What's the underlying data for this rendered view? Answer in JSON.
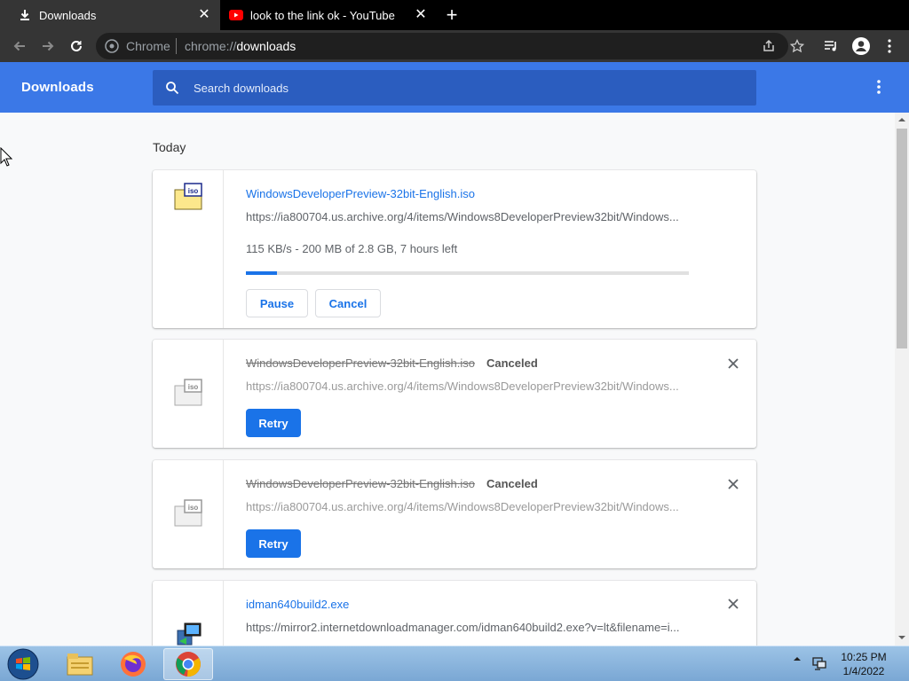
{
  "tabs": [
    {
      "title": "Downloads",
      "icon": "download-icon",
      "active": true
    },
    {
      "title": "look to the link ok - YouTube",
      "icon": "youtube-icon",
      "active": false
    }
  ],
  "omnibox": {
    "scheme_label": "Chrome",
    "url_prefix": "chrome://",
    "url_host": "downloads"
  },
  "header": {
    "title": "Downloads",
    "search_placeholder": "Search downloads"
  },
  "section_label": "Today",
  "downloads": [
    {
      "filename": "WindowsDeveloperPreview-32bit-English.iso",
      "url": "https://ia800704.us.archive.org/4/items/Windows8DeveloperPreview32bit/Windows...",
      "progress_text": "115 KB/s - 200 MB of 2.8 GB, 7 hours left",
      "progress_fraction": 0.07,
      "pause_label": "Pause",
      "cancel_label": "Cancel"
    },
    {
      "filename": "WindowsDeveloperPreview-32bit-English.iso",
      "status": "Canceled",
      "url": "https://ia800704.us.archive.org/4/items/Windows8DeveloperPreview32bit/Windows...",
      "retry_label": "Retry"
    },
    {
      "filename": "WindowsDeveloperPreview-32bit-English.iso",
      "status": "Canceled",
      "url": "https://ia800704.us.archive.org/4/items/Windows8DeveloperPreview32bit/Windows...",
      "retry_label": "Retry"
    },
    {
      "filename": "idman640build2.exe",
      "url": "https://mirror2.internetdownloadmanager.com/idman640build2.exe?v=lt&filename=i..."
    }
  ],
  "taskbar": {
    "time": "10:25 PM",
    "date": "1/4/2022"
  },
  "colors": {
    "accent": "#1a73e8",
    "header": "#3b78e7"
  }
}
